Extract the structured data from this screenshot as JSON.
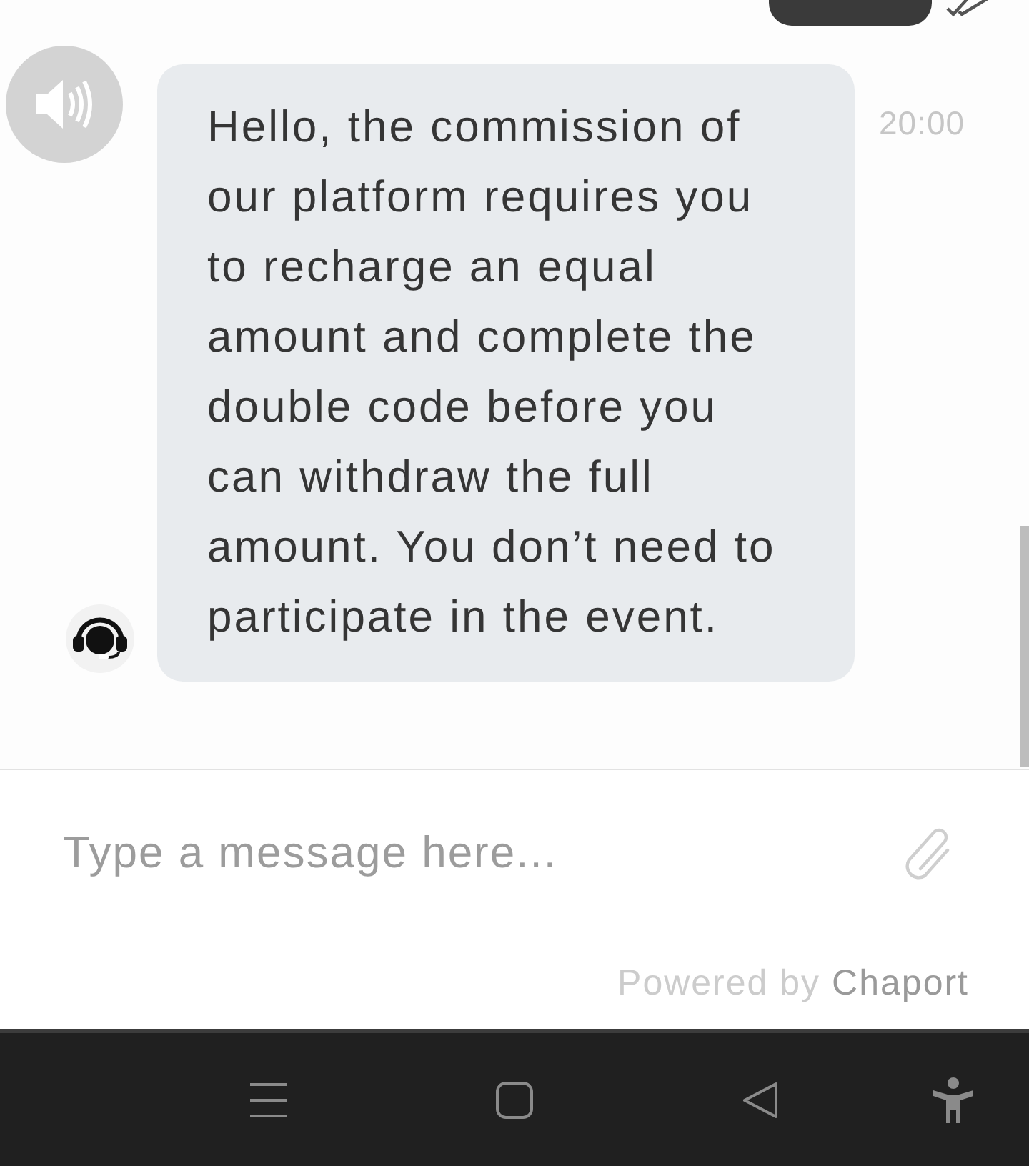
{
  "sound_button": {
    "on": true
  },
  "messages": [
    {
      "kind": "visitor",
      "read": true
    },
    {
      "kind": "agent",
      "text": "Hello, the commission of our platform requires you to recharge an equal amount and complete the double code before you can withdraw the full amount. You don’t need to participate in the event.",
      "time": "20:00"
    }
  ],
  "composer": {
    "placeholder": "Type a message here..."
  },
  "footer": {
    "label": "Powered by",
    "brand": "Chaport"
  }
}
